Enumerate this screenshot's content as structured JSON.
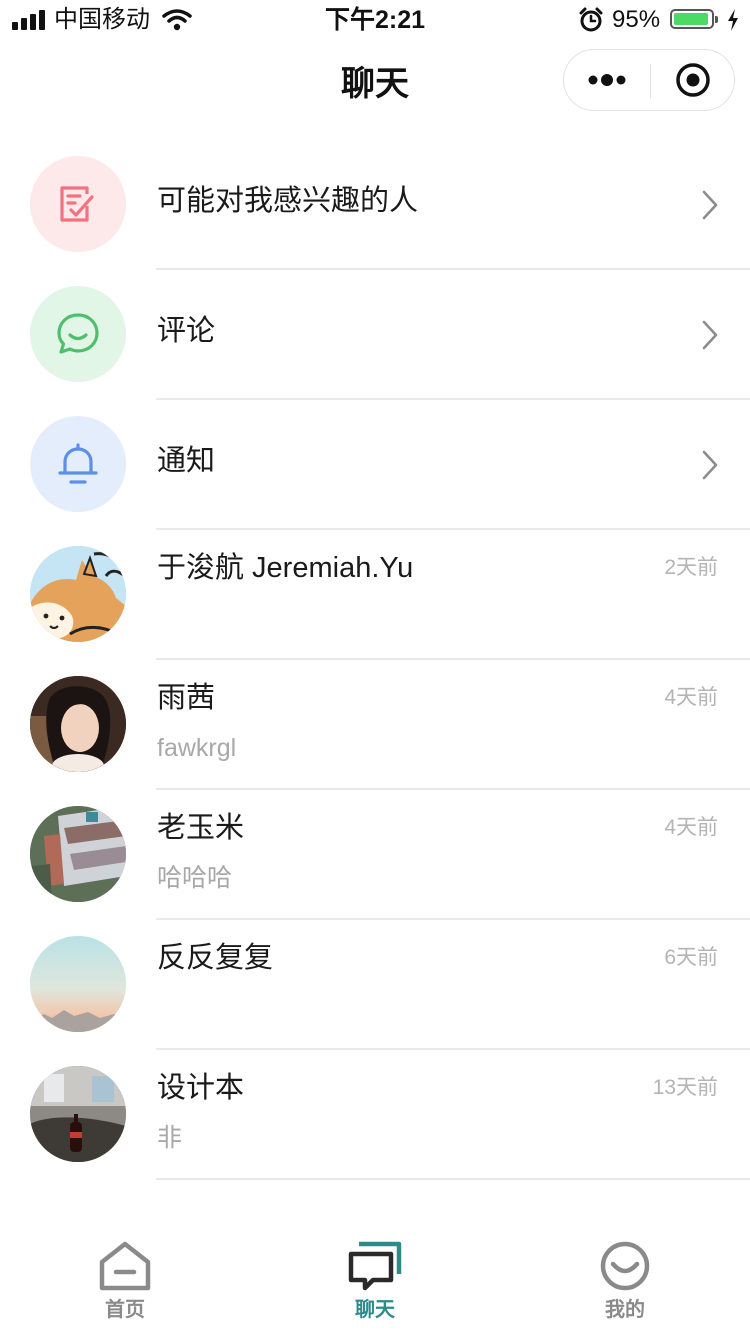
{
  "status_bar": {
    "carrier": "中国移动",
    "time": "下午2:21",
    "battery_percent": "95%",
    "battery_level": 0.95
  },
  "nav": {
    "title": "聊天"
  },
  "system_rows": [
    {
      "title": "可能对我感兴趣的人",
      "icon": "interest-checklist-icon",
      "color": "#f2737f",
      "bg": "#fde8ea"
    },
    {
      "title": "评论",
      "icon": "comment-bubble-icon",
      "color": "#4fbf6c",
      "bg": "#e2f6e8"
    },
    {
      "title": "通知",
      "icon": "bell-icon",
      "color": "#5d8ee8",
      "bg": "#e4edfb"
    }
  ],
  "chats": [
    {
      "name": "于浚航 Jeremiah.Yu",
      "preview": "",
      "time": "2天前"
    },
    {
      "name": "雨茜",
      "preview": "fawkrgl",
      "time": "4天前"
    },
    {
      "name": "老玉米",
      "preview": "哈哈哈",
      "time": "4天前"
    },
    {
      "name": "反反复复",
      "preview": "",
      "time": "6天前"
    },
    {
      "name": "设计本",
      "preview": "非",
      "time": "13天前"
    }
  ],
  "tabs": [
    {
      "label": "首页",
      "icon": "home-icon",
      "active": false
    },
    {
      "label": "聊天",
      "icon": "chat-icon",
      "active": true
    },
    {
      "label": "我的",
      "icon": "profile-smile-icon",
      "active": false
    }
  ],
  "colors": {
    "active_tab": "#2f8a8a",
    "inactive_tab": "#8a8a8a",
    "separator": "#e9e9e9",
    "secondary_text": "#a8a8a8"
  }
}
